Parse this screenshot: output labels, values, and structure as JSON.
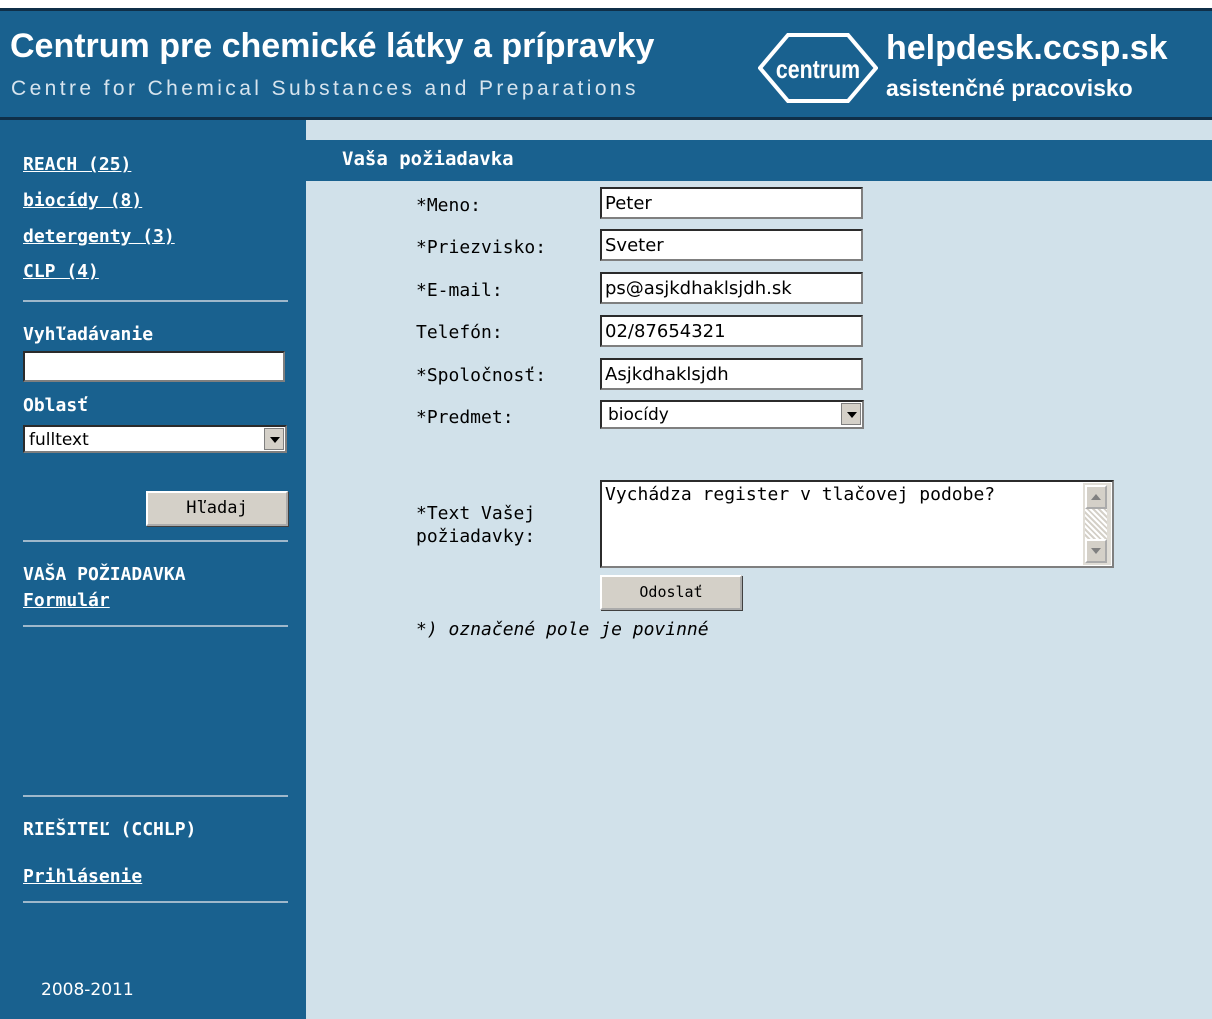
{
  "header": {
    "title": "Centrum pre chemické látky a prípravky",
    "subtitle": "Centre for Chemical Substances and Preparations",
    "logo_text": "centrum",
    "site": "helpdesk.ccsp.sk",
    "site_subtitle": "asistenčné pracovisko",
    "colors": {
      "primary": "#19618f",
      "dark": "#0f2f48",
      "content_bg": "#d1e1ea"
    }
  },
  "sidebar": {
    "categories": [
      {
        "label": "REACH (25)"
      },
      {
        "label": "biocídy (8)"
      },
      {
        "label": "detergenty (3)"
      },
      {
        "label": "CLP (4)"
      }
    ],
    "search": {
      "heading": "Vyhľadávanie",
      "value": ""
    },
    "area": {
      "heading": "Oblasť",
      "selected": "fulltext"
    },
    "search_button": "Hľadaj",
    "request_section": {
      "heading": "VAŠA POŽIADAVKA",
      "link": "Formulár"
    },
    "solver_section": {
      "heading": "RIEŠITEĽ (CCHLP)",
      "link": "Prihlásenie"
    },
    "years": "2008-2011"
  },
  "main": {
    "title": "Vaša požiadavka",
    "form": {
      "name": {
        "label": "*Meno:",
        "value": "Peter"
      },
      "surname": {
        "label": "*Priezvisko:",
        "value": "Sveter"
      },
      "email": {
        "label": "*E-mail:",
        "value": "ps@asjkdhaklsjdh.sk"
      },
      "phone": {
        "label": "Telefón:",
        "value": "02/87654321"
      },
      "company": {
        "label": "*Spoločnosť:",
        "value": "Asjkdhaklsjdh"
      },
      "subject": {
        "label": "*Predmet:",
        "selected": "biocídy"
      },
      "text": {
        "label_line1": "*Text Vašej",
        "label_line2": "požiadavky:",
        "value": "Vychádza register v tlačovej podobe?"
      },
      "submit_label": "Odoslať",
      "required_note": "*) označené pole je povinné"
    }
  }
}
